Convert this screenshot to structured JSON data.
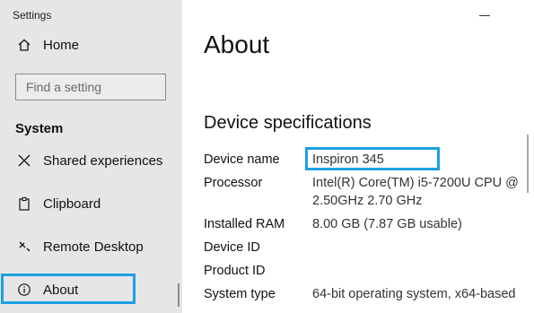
{
  "window": {
    "title": "Settings"
  },
  "sidebar": {
    "home_label": "Home",
    "search_placeholder": "Find a setting",
    "section_heading": "System",
    "items": [
      {
        "label": "Shared experiences",
        "icon": "shared-experiences-icon"
      },
      {
        "label": "Clipboard",
        "icon": "clipboard-icon"
      },
      {
        "label": "Remote Desktop",
        "icon": "remote-desktop-icon"
      },
      {
        "label": "About",
        "icon": "info-icon",
        "selected": true
      }
    ]
  },
  "main": {
    "title": "About",
    "section_title": "Device specifications",
    "specs": [
      {
        "label": "Device name",
        "value": "Inspiron 345"
      },
      {
        "label": "Processor",
        "value": "Intel(R) Core(TM) i5-7200U CPU @",
        "value2": "2.50GHz   2.70 GHz"
      },
      {
        "label": "Installed RAM",
        "value": "8.00 GB (7.87 GB usable)"
      },
      {
        "label": "Device ID",
        "value": ""
      },
      {
        "label": "Product ID",
        "value": ""
      },
      {
        "label": "System type",
        "value": "64-bit operating system, x64-based"
      }
    ]
  },
  "colors": {
    "highlight": "#1ba1e2",
    "sidebar_bg": "#e6e6e6"
  }
}
